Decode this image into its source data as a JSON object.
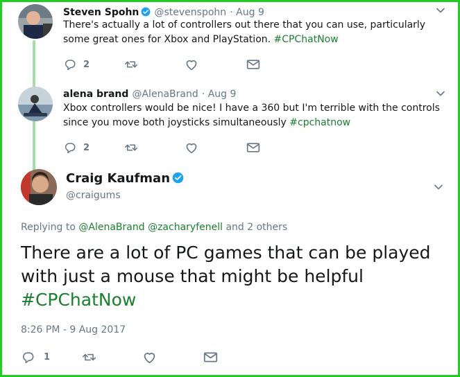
{
  "tweets": [
    {
      "name": "Steven Spohn",
      "handle": "@stevenspohn",
      "date": "· Aug 9",
      "text": "There's actually a lot of controllers out there that you can use, particularly some great ones for Xbox and PlayStation.",
      "hashtag": "#CPChatNow",
      "reply_count": "2"
    },
    {
      "name": "alena brand",
      "handle": "@AlenaBrand",
      "date": "· Aug 9",
      "text": "Xbox controllers would be nice! I have a 360 but I'm terrible with the controls since you move both joysticks simultaneously",
      "hashtag": "#cpchatnow",
      "reply_count": "2"
    }
  ],
  "main": {
    "name": "Craig Kaufman",
    "handle": "@craigums",
    "replying_prefix": "Replying to",
    "replying_users": [
      "@AlenaBrand",
      "@zacharyfenell"
    ],
    "replying_suffix": "and 2 others",
    "text": "There are a lot of PC games that can be played with just a mouse that might be helpful",
    "hashtag": "#CPChatNow",
    "timestamp": "8:26 PM - 9 Aug 2017",
    "reply_count": "1"
  },
  "colors": {
    "frame": "#22cc22",
    "hashtag": "#1a7f2e",
    "verified": "#1da1f2",
    "thread_line": "#a9dba5"
  },
  "icons": [
    "reply-icon",
    "retweet-icon",
    "like-icon",
    "dm-icon",
    "verified-icon",
    "chevron-down-icon"
  ]
}
